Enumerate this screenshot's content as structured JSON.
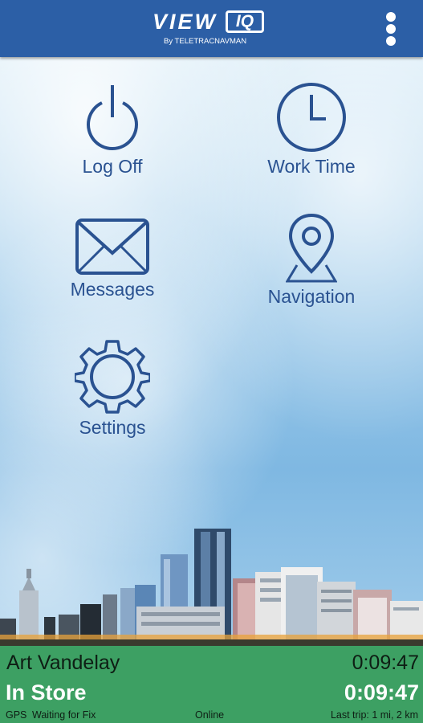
{
  "header": {
    "logo_word": "VIEW",
    "logo_iq": "IQ",
    "logo_sub": "By TELETRACNAVMAN",
    "menu_icon": "overflow-menu-icon"
  },
  "menu": {
    "log_off": {
      "label": "Log Off",
      "icon": "power-icon"
    },
    "work_time": {
      "label": "Work Time",
      "icon": "clock-icon"
    },
    "messages": {
      "label": "Messages",
      "icon": "envelope-icon"
    },
    "navigation": {
      "label": "Navigation",
      "icon": "map-pin-icon"
    },
    "settings": {
      "label": "Settings",
      "icon": "gear-icon"
    }
  },
  "status": {
    "driver_name": "Art Vandelay",
    "driver_timer": "0:09:47",
    "state": "In Store",
    "state_timer": "0:09:47",
    "gps_label": "GPS",
    "gps_status": "Waiting for Fix",
    "connection": "Online",
    "last_trip": "Last trip: 1 mi, 2 km"
  },
  "colors": {
    "header_bg": "#2c5fa6",
    "icon_color": "#2a5291",
    "status_bg": "#3da063"
  }
}
